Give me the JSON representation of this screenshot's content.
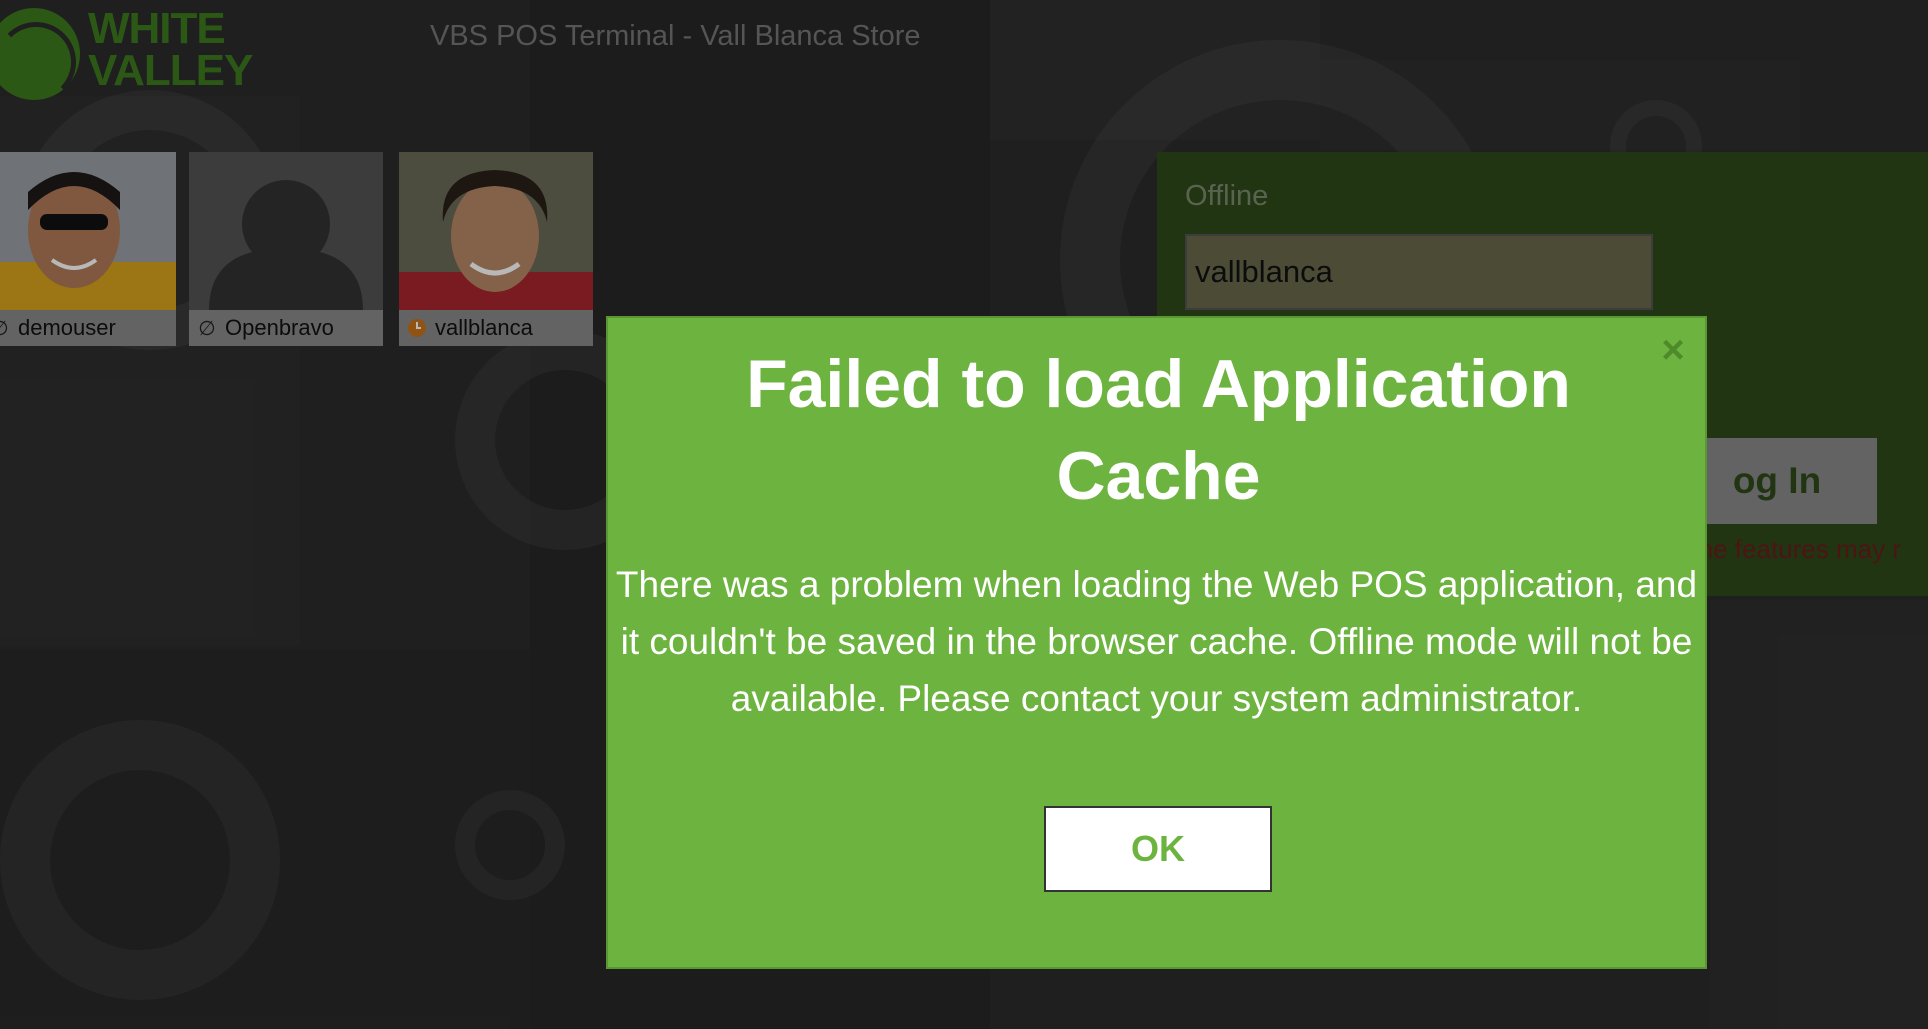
{
  "header": {
    "logo_line1": "WHITE",
    "logo_line2": "VALLEY",
    "title": "VBS POS Terminal - Vall Blanca Store"
  },
  "users": [
    {
      "name": "demouser",
      "status": "offline"
    },
    {
      "name": "Openbravo",
      "status": "offline"
    },
    {
      "name": "vallblanca",
      "status": "away"
    }
  ],
  "login": {
    "connection_status": "Offline",
    "username_value": "vallblanca",
    "login_button_visible_text": "og In",
    "warning_visible_text": "ome features may r"
  },
  "dialog": {
    "title": "Failed to load Application Cache",
    "message": "There was a problem when loading the Web POS application, and it couldn't be saved in the browser cache. Offline mode will not be available. Please contact your system administrator.",
    "ok_label": "OK",
    "close_icon": "close-icon"
  },
  "colors": {
    "dialog_bg": "#6db33f",
    "brand_green": "#3e7a1f",
    "background": "#2b2b2b"
  }
}
